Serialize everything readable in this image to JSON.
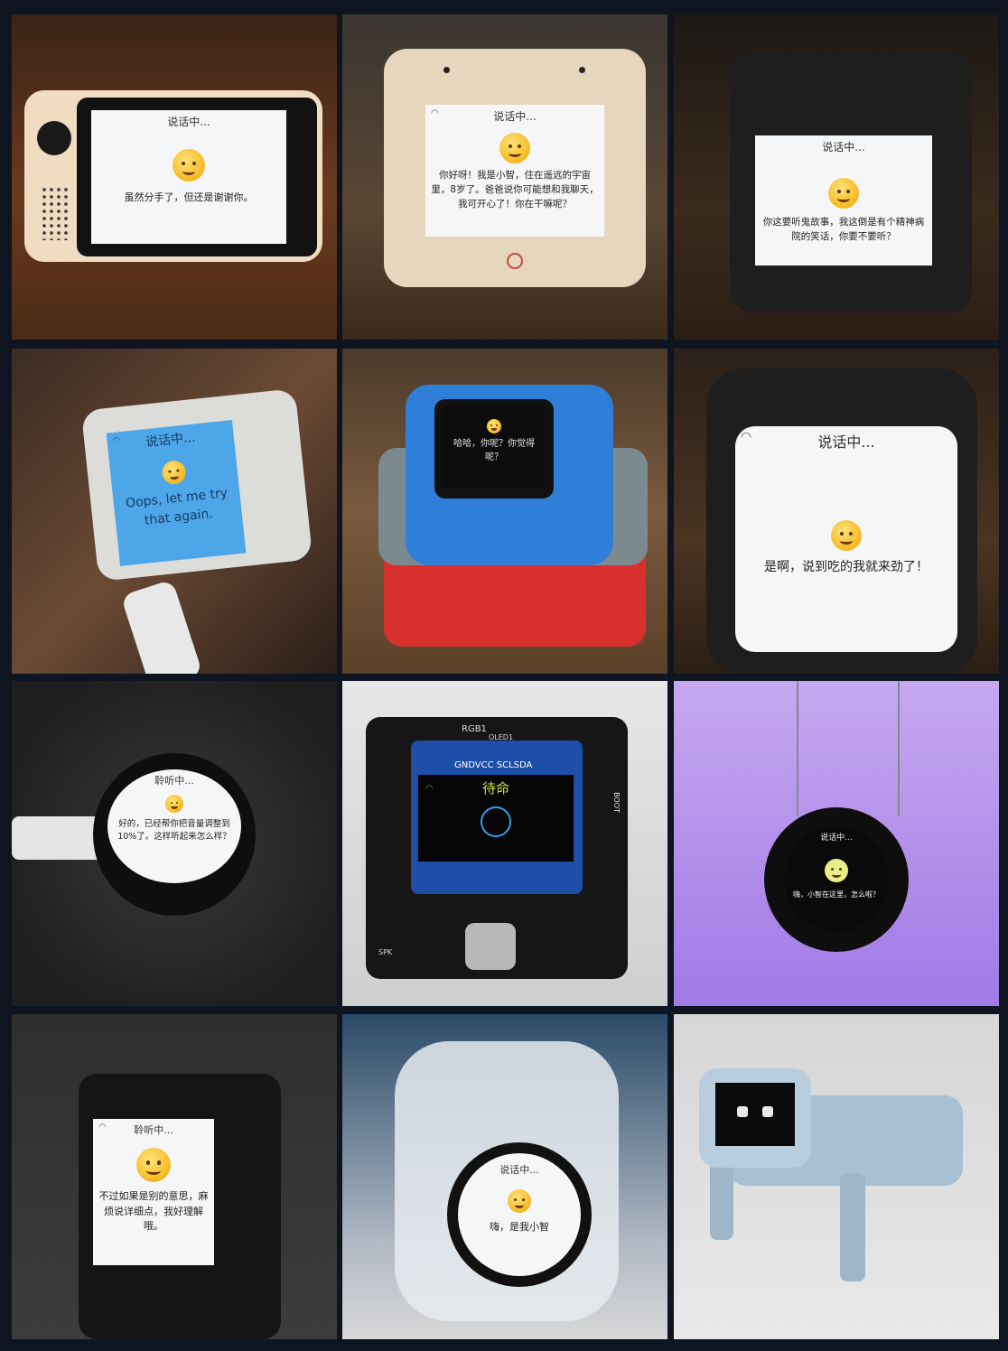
{
  "tiles": [
    {
      "status": "说话中...",
      "message": "虽然分手了，但还是谢谢你。",
      "emoji": "relieved-face-icon"
    },
    {
      "status": "说话中...",
      "message": "你好呀！我是小智，住在遥远的宇宙里，8岁了。爸爸说你可能想和我聊天，我可开心了！你在干嘛呢？",
      "emoji": "smiling-face-icon"
    },
    {
      "status": "说话中...",
      "message": "你这要听鬼故事，我这倒是有个精神病院的笑话，你要不要听？",
      "emoji": "thinking-face-icon"
    },
    {
      "status": "说话中...",
      "message": "Oops, let me try that again.",
      "emoji": "laughing-tears-face-icon"
    },
    {
      "status": "",
      "message": "哈哈，你呢？你觉得呢？",
      "emoji": "smiling-face-icon"
    },
    {
      "status": "说话中...",
      "message": "是啊，说到吃的我就来劲了！",
      "emoji": "yum-face-icon"
    },
    {
      "status": "聆听中...",
      "message": "好的，已经帮你把音量调整到10%了。这样听起来怎么样？",
      "emoji": "neutral-face-icon"
    },
    {
      "status": "待命",
      "message": "",
      "emoji": "robot-face-icon",
      "board_labels": [
        "RGB1",
        "OLED1",
        "GNDVCC SCLSDA",
        "SPK",
        "BOOT"
      ]
    },
    {
      "status": "说话中...",
      "message": "嗨，小智在这里，怎么啦？",
      "emoji": "slight-smile-face-icon"
    },
    {
      "status": "聆听中...",
      "message": "不过如果是别的意思，麻烦说详细点，我好理解哦。",
      "emoji": "neutral-face-icon"
    },
    {
      "status": "说话中...",
      "message": "嗨，是我小智",
      "emoji": "smiling-face-icon"
    },
    {
      "status": "",
      "message": "",
      "emoji": "robot-eyes-icon"
    }
  ]
}
